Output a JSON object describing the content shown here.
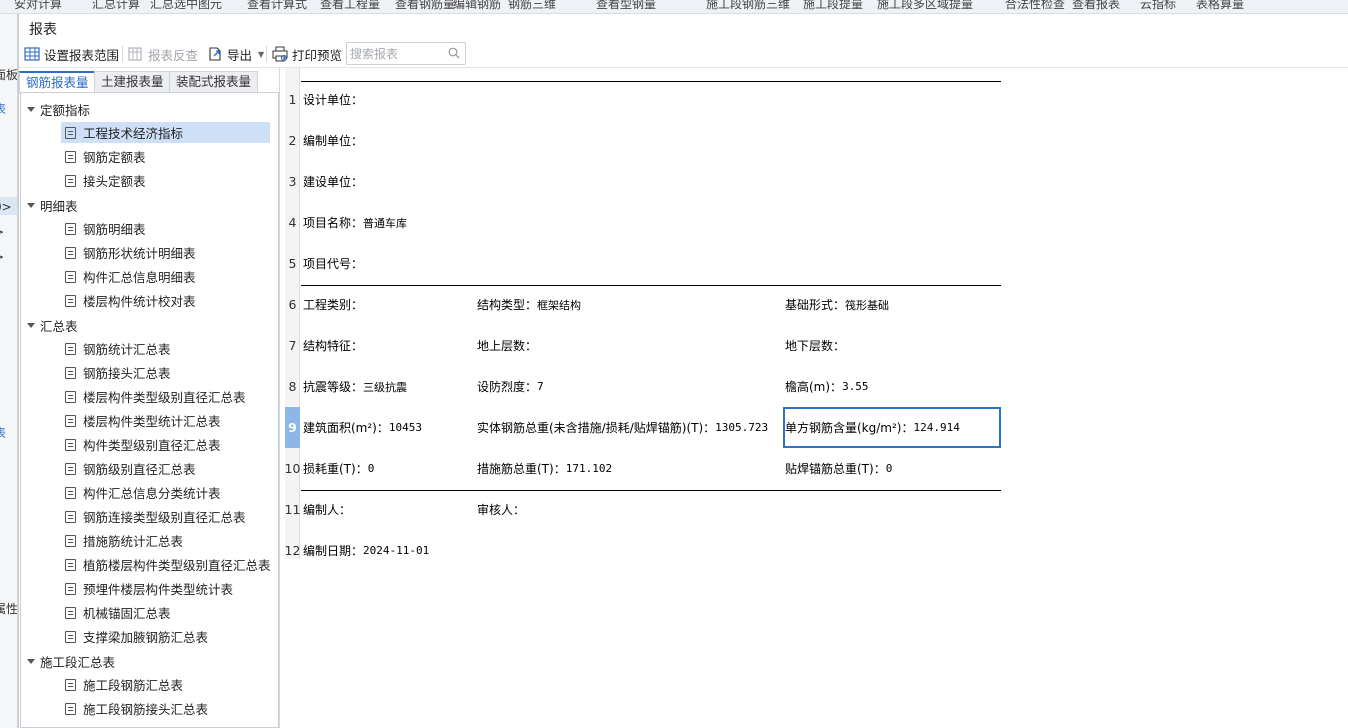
{
  "background": {
    "menubar_items": [
      "安对计算",
      "汇总计算",
      "汇总选中图元",
      "查看计算式",
      "查看工程量",
      "查看钢筋量",
      "编辑钢筋",
      "钢筋三维",
      "查看型钢量",
      "施工段钢筋三维",
      "施工段提量",
      "施工段多区域提量",
      "合法性检查",
      "查看报表",
      "云指标",
      "表格算量"
    ],
    "left_fragments": [
      "面板",
      "表",
      "·",
      "0>",
      ">",
      ">",
      "表",
      "属性"
    ]
  },
  "dialog": {
    "title": "报表",
    "toolbar": {
      "set_range": "设置报表范围",
      "reverse_check": "报表反查",
      "export": "导出",
      "print_preview": "打印预览",
      "search_placeholder": "搜索报表"
    },
    "tabs": [
      "钢筋报表量",
      "土建报表量",
      "装配式报表量"
    ],
    "tree": [
      {
        "label": "定额指标",
        "items": [
          "工程技术经济指标",
          "钢筋定额表",
          "接头定额表"
        ]
      },
      {
        "label": "明细表",
        "items": [
          "钢筋明细表",
          "钢筋形状统计明细表",
          "构件汇总信息明细表",
          "楼层构件统计校对表"
        ]
      },
      {
        "label": "汇总表",
        "items": [
          "钢筋统计汇总表",
          "钢筋接头汇总表",
          "楼层构件类型级别直径汇总表",
          "楼层构件类型统计汇总表",
          "构件类型级别直径汇总表",
          "钢筋级别直径汇总表",
          "构件汇总信息分类统计表",
          "钢筋连接类型级别直径汇总表",
          "措施筋统计汇总表",
          "植筋楼层构件类型级别直径汇总表",
          "预埋件楼层构件类型统计表",
          "机械锚固汇总表",
          "支撑梁加腋钢筋汇总表"
        ]
      },
      {
        "label": "施工段汇总表",
        "items": [
          "施工段钢筋汇总表",
          "施工段钢筋接头汇总表"
        ]
      }
    ],
    "selected_item": "工程技术经济指标"
  },
  "report": {
    "row_numbers": [
      "1",
      "2",
      "3",
      "4",
      "5",
      "6",
      "7",
      "8",
      "9",
      "10",
      "11",
      "12"
    ],
    "active_row": "9",
    "rows": [
      [
        {
          "label": "设计单位：",
          "value": ""
        }
      ],
      [
        {
          "label": "编制单位：",
          "value": ""
        }
      ],
      [
        {
          "label": "建设单位：",
          "value": ""
        }
      ],
      [
        {
          "label": "项目名称：",
          "value": "普通车库"
        }
      ],
      [
        {
          "label": "项目代号：",
          "value": ""
        }
      ],
      [
        {
          "label": "工程类别：",
          "value": ""
        },
        {
          "label": "结构类型：",
          "value": "框架结构"
        },
        {
          "label": "基础形式：",
          "value": "筏形基础"
        }
      ],
      [
        {
          "label": "结构特征：",
          "value": ""
        },
        {
          "label": "地上层数：",
          "value": ""
        },
        {
          "label": "地下层数：",
          "value": ""
        }
      ],
      [
        {
          "label": "抗震等级：",
          "value": "三级抗震"
        },
        {
          "label": "设防烈度：",
          "value": "7"
        },
        {
          "label": "檐高(m)：",
          "value": "3.55"
        }
      ],
      [
        {
          "label": "建筑面积(m²)：",
          "value": "10453"
        },
        {
          "label": "实体钢筋总重(未含措施/损耗/贴焊锚筋)(T)：",
          "value": "1305.723"
        },
        {
          "label": "单方钢筋含量(kg/m²)：",
          "value": "124.914"
        }
      ],
      [
        {
          "label": "损耗重(T)：",
          "value": "0"
        },
        {
          "label": "措施筋总重(T)：",
          "value": "171.102"
        },
        {
          "label": "贴焊锚筋总重(T)：",
          "value": "0"
        }
      ],
      [
        {
          "label": "编制人：",
          "value": ""
        },
        {
          "label": "审核人：",
          "value": ""
        }
      ],
      [
        {
          "label": "编制日期：",
          "value": "2024-11-01"
        }
      ]
    ]
  },
  "colors": {
    "accent": "#2b6cc4",
    "selected_bg": "#cde0f7",
    "active_row": "#8bb8e8"
  }
}
